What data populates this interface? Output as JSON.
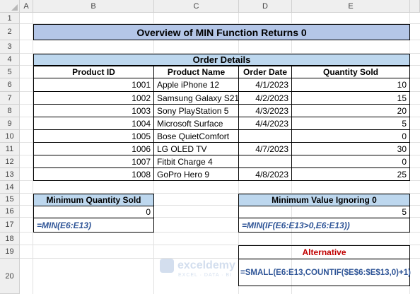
{
  "columns": [
    "A",
    "B",
    "C",
    "D",
    "E"
  ],
  "rows": [
    "1",
    "2",
    "3",
    "4",
    "5",
    "6",
    "7",
    "8",
    "9",
    "10",
    "11",
    "12",
    "13",
    "14",
    "15",
    "16",
    "17",
    "18",
    "19",
    "20"
  ],
  "title": "Overview of MIN Function Returns 0",
  "order_details": "Order Details",
  "table": {
    "headers": [
      "Product ID",
      "Product Name",
      "Order Date",
      "Quantity Sold"
    ],
    "rows": [
      [
        "1001",
        "Apple iPhone 12",
        "4/1/2023",
        "10"
      ],
      [
        "1002",
        "Samsung Galaxy S21",
        "4/2/2023",
        "15"
      ],
      [
        "1003",
        "Sony PlayStation 5",
        "4/3/2023",
        "20"
      ],
      [
        "1004",
        "Microsoft Surface",
        "4/4/2023",
        "5"
      ],
      [
        "1005",
        "Bose QuietComfort",
        "",
        "0"
      ],
      [
        "1006",
        "LG OLED TV",
        "4/7/2023",
        "30"
      ],
      [
        "1007",
        "Fitbit Charge 4",
        "",
        "0"
      ],
      [
        "1008",
        "GoPro Hero 9",
        "4/8/2023",
        "25"
      ]
    ]
  },
  "min_box": {
    "label": "Minimum Quantity Sold",
    "value": "0",
    "formula": "=MIN(E6:E13)"
  },
  "min_ignore_box": {
    "label": "Minimum Value Ignoring 0",
    "value": "5",
    "formula": "=MIN(IF(E6:E13>0,E6:E13))"
  },
  "alternative": {
    "label": "Alternative",
    "formula": "=SMALL(E6:E13,COUNTIF($E$6:$E$13,0)+1)"
  },
  "watermark": {
    "name": "exceldemy",
    "tagline": "EXCEL · DATA · BI"
  },
  "colors": {
    "title_bg": "#b4c6e7",
    "subheader_bg": "#bdd7ee",
    "formula": "#2f5597",
    "alternative": "#c00000"
  }
}
